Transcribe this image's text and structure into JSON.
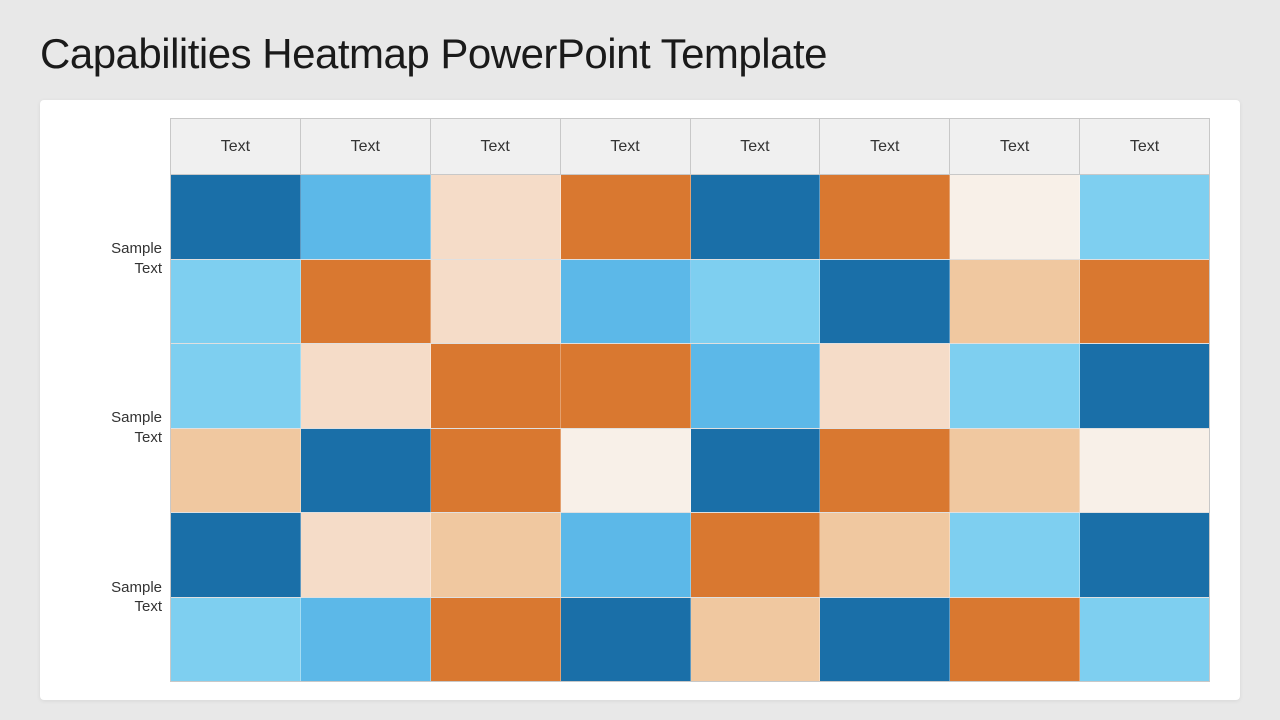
{
  "title": "Capabilities Heatmap PowerPoint Template",
  "header": {
    "columns": [
      "Text",
      "Text",
      "Text",
      "Text",
      "Text",
      "Text",
      "Text",
      "Text"
    ]
  },
  "rows": [
    {
      "label": "Sample\nText",
      "sub_rows": [
        [
          "dark-blue",
          "light-blue",
          "pale-peach",
          "orange",
          "dark-blue",
          "orange",
          "empty",
          "sky-blue"
        ],
        [
          "sky-blue",
          "orange",
          "pale-peach",
          "light-blue",
          "sky-blue",
          "dark-blue",
          "peach",
          "orange"
        ]
      ]
    },
    {
      "label": "Sample\nText",
      "sub_rows": [
        [
          "sky-blue",
          "pale-peach",
          "orange",
          "orange",
          "light-blue",
          "pale-peach",
          "sky-blue",
          "dark-blue"
        ],
        [
          "peach",
          "dark-blue",
          "orange",
          "empty",
          "dark-blue",
          "orange",
          "peach",
          "empty"
        ]
      ]
    },
    {
      "label": "Sample\nText",
      "sub_rows": [
        [
          "dark-blue",
          "pale-peach",
          "peach",
          "light-blue",
          "orange",
          "peach",
          "sky-blue",
          "dark-blue"
        ],
        [
          "sky-blue",
          "light-blue",
          "orange",
          "dark-blue",
          "peach",
          "dark-blue",
          "orange",
          "sky-blue"
        ]
      ]
    }
  ],
  "colors": {
    "dark-blue": "#1a6fa8",
    "light-blue": "#5cb8e8",
    "pale-peach": "#f5dcc8",
    "orange": "#d97830",
    "sky-blue": "#7ecff0",
    "mid-blue": "#1a7fbc",
    "peach": "#f0c8a0",
    "empty": "#f8f0e8"
  }
}
